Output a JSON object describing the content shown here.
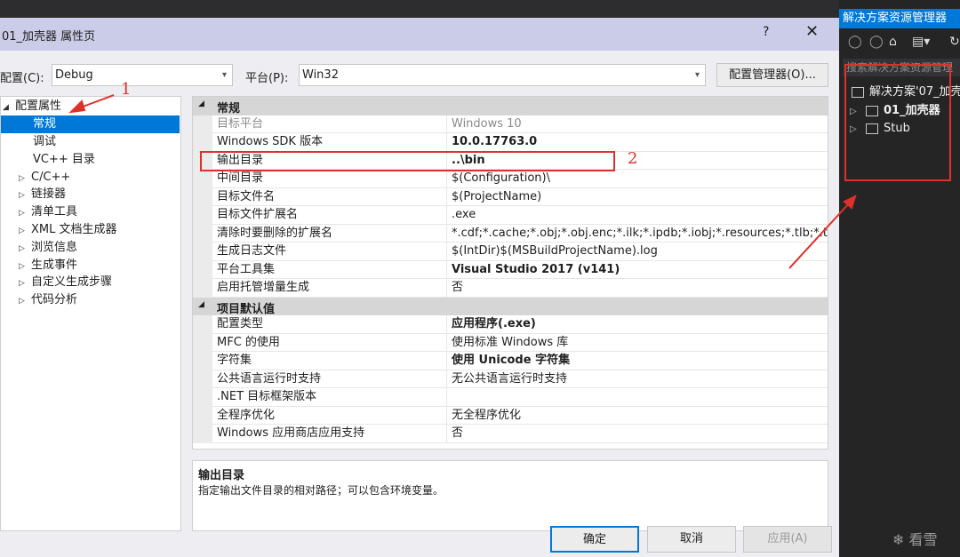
{
  "dialog": {
    "title": "01_加壳器 属性页",
    "help": "?",
    "close": "✕",
    "config_label": "配置(C):",
    "config_value": "Debug",
    "platform_label": "平台(P):",
    "platform_value": "Win32",
    "config_manager_button": "配置管理器(O)..."
  },
  "tree": {
    "root": "配置属性",
    "items": [
      {
        "label": "常规",
        "selected": true,
        "expandable": false
      },
      {
        "label": "调试",
        "selected": false,
        "expandable": false
      },
      {
        "label": "VC++ 目录",
        "selected": false,
        "expandable": false
      },
      {
        "label": "C/C++",
        "selected": false,
        "expandable": true
      },
      {
        "label": "链接器",
        "selected": false,
        "expandable": true
      },
      {
        "label": "清单工具",
        "selected": false,
        "expandable": true
      },
      {
        "label": "XML 文档生成器",
        "selected": false,
        "expandable": true
      },
      {
        "label": "浏览信息",
        "selected": false,
        "expandable": true
      },
      {
        "label": "生成事件",
        "selected": false,
        "expandable": true
      },
      {
        "label": "自定义生成步骤",
        "selected": false,
        "expandable": true
      },
      {
        "label": "代码分析",
        "selected": false,
        "expandable": true
      }
    ]
  },
  "grid": {
    "section1": "常规",
    "rows1": [
      {
        "name": "目标平台",
        "value": "Windows 10",
        "style": "dim"
      },
      {
        "name": "Windows SDK 版本",
        "value": "10.0.17763.0",
        "style": "bold"
      },
      {
        "name": "输出目录",
        "value": "..\\bin",
        "style": "bold"
      },
      {
        "name": "中间目录",
        "value": "$(Configuration)\\",
        "style": ""
      },
      {
        "name": "目标文件名",
        "value": "$(ProjectName)",
        "style": ""
      },
      {
        "name": "目标文件扩展名",
        "value": ".exe",
        "style": ""
      },
      {
        "name": "清除时要删除的扩展名",
        "value": "*.cdf;*.cache;*.obj;*.obj.enc;*.ilk;*.ipdb;*.iobj;*.resources;*.tlb;*.tli;",
        "style": ""
      },
      {
        "name": "生成日志文件",
        "value": "$(IntDir)$(MSBuildProjectName).log",
        "style": ""
      },
      {
        "name": "平台工具集",
        "value": "Visual Studio 2017 (v141)",
        "style": "bold"
      },
      {
        "name": "启用托管增量生成",
        "value": "否",
        "style": ""
      }
    ],
    "section2": "项目默认值",
    "rows2": [
      {
        "name": "配置类型",
        "value": "应用程序(.exe)",
        "style": "bold"
      },
      {
        "name": "MFC 的使用",
        "value": "使用标准 Windows 库",
        "style": ""
      },
      {
        "name": "字符集",
        "value": "使用 Unicode 字符集",
        "style": "bold"
      },
      {
        "name": "公共语言运行时支持",
        "value": "无公共语言运行时支持",
        "style": ""
      },
      {
        "name": ".NET 目标框架版本",
        "value": "",
        "style": ""
      },
      {
        "name": "全程序优化",
        "value": "无全程序优化",
        "style": ""
      },
      {
        "name": "Windows 应用商店应用支持",
        "value": "否",
        "style": ""
      }
    ]
  },
  "description": {
    "title": "输出目录",
    "text": "指定输出文件目录的相对路径；可以包含环境变量。"
  },
  "buttons": {
    "ok": "确定",
    "cancel": "取消",
    "apply": "应用(A)"
  },
  "annotations": {
    "num1": "1",
    "num2": "2",
    "color": "#e0302a"
  },
  "solution_explorer": {
    "title": "解决方案资源管理器",
    "search_placeholder": "搜索解决方案资源管理",
    "solution": "解决方案'07_加壳",
    "project1": "01_加壳器",
    "project2": "Stub"
  },
  "watermark": "看雪",
  "colors": {
    "selection": "#0078d7",
    "title_bar": "#cbcde8",
    "dark_panel": "#252526"
  }
}
